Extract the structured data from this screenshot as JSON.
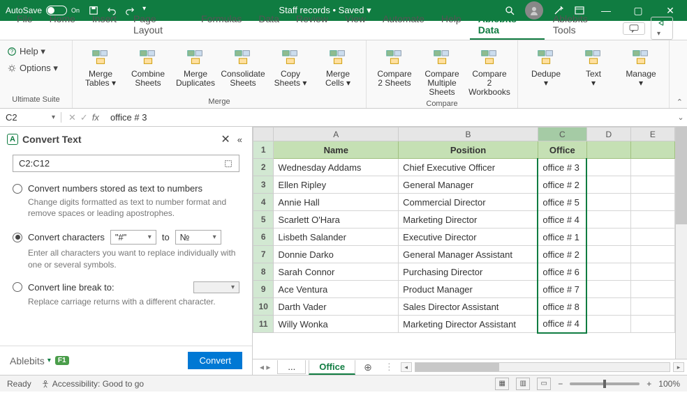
{
  "titlebar": {
    "autosave_label": "AutoSave",
    "autosave_state": "On",
    "title": "Staff records • Saved ▾"
  },
  "ribbon_tabs": [
    "File",
    "Home",
    "Insert",
    "Page Layout",
    "Formulas",
    "Data",
    "Review",
    "View",
    "Automate",
    "Help",
    "Ablebits Data",
    "Ablebits Tools"
  ],
  "ribbon_active_index": 10,
  "suite_group": {
    "help": "Help ▾",
    "options": "Options ▾",
    "label": "Ultimate Suite"
  },
  "ribbon_groups": [
    {
      "label": "Merge",
      "buttons": [
        {
          "label": "Merge Tables ▾"
        },
        {
          "label": "Combine Sheets"
        },
        {
          "label": "Merge Duplicates"
        },
        {
          "label": "Consolidate Sheets"
        },
        {
          "label": "Copy Sheets ▾"
        },
        {
          "label": "Merge Cells ▾"
        }
      ]
    },
    {
      "label": "Compare",
      "buttons": [
        {
          "label": "Compare 2 Sheets"
        },
        {
          "label": "Compare Multiple Sheets"
        },
        {
          "label": "Compare 2 Workbooks"
        }
      ]
    },
    {
      "label": "",
      "buttons": [
        {
          "label": "Dedupe ▾"
        },
        {
          "label": "Text ▾"
        },
        {
          "label": "Manage ▾"
        }
      ]
    }
  ],
  "formula_bar": {
    "name_box": "C2",
    "formula": "office # 3"
  },
  "panel": {
    "title": "Convert Text",
    "range": "C2:C12",
    "opt1_label": "Convert numbers stored as text to numbers",
    "opt1_desc": "Change digits formatted as text to number format and remove spaces or leading apostrophes.",
    "opt2_label": "Convert characters",
    "opt2_from": "\"#\"",
    "opt2_to_label": "to",
    "opt2_to": "№",
    "opt2_desc": "Enter all characters you want to replace individually with one or several symbols.",
    "opt3_label": "Convert line break to:",
    "opt3_value": "",
    "opt3_desc": "Replace carriage returns with a different character.",
    "selected_option": 2,
    "footer_brand": "Ablebits",
    "convert_btn": "Convert"
  },
  "columns": [
    "A",
    "B",
    "C",
    "D",
    "E"
  ],
  "headers": [
    "Name",
    "Position",
    "Office"
  ],
  "rows": [
    {
      "n": 2,
      "a": "Wednesday Addams",
      "b": "Chief Executive Officer",
      "c": "office # 3"
    },
    {
      "n": 3,
      "a": "Ellen Ripley",
      "b": "General Manager",
      "c": "office # 2"
    },
    {
      "n": 4,
      "a": "Annie Hall",
      "b": "Commercial Director",
      "c": "office # 5"
    },
    {
      "n": 5,
      "a": "Scarlett O'Hara",
      "b": "Marketing Director",
      "c": "office # 4"
    },
    {
      "n": 6,
      "a": "Lisbeth Salander",
      "b": "Executive Director",
      "c": "office # 1"
    },
    {
      "n": 7,
      "a": "Donnie Darko",
      "b": "General Manager Assistant",
      "c": "office # 2"
    },
    {
      "n": 8,
      "a": "Sarah Connor",
      "b": "Purchasing Director",
      "c": "office # 6"
    },
    {
      "n": 9,
      "a": "Ace Ventura",
      "b": "Product Manager",
      "c": "office # 7"
    },
    {
      "n": 10,
      "a": "Darth Vader",
      "b": "Sales Director Assistant",
      "c": "office # 8"
    },
    {
      "n": 11,
      "a": "Willy Wonka",
      "b": "Marketing Director Assistant",
      "c": "office # 4"
    }
  ],
  "sheet": {
    "active": "Office",
    "ellipsis": "..."
  },
  "statusbar": {
    "ready": "Ready",
    "accessibility": "Accessibility: Good to go",
    "zoom": "100%"
  }
}
